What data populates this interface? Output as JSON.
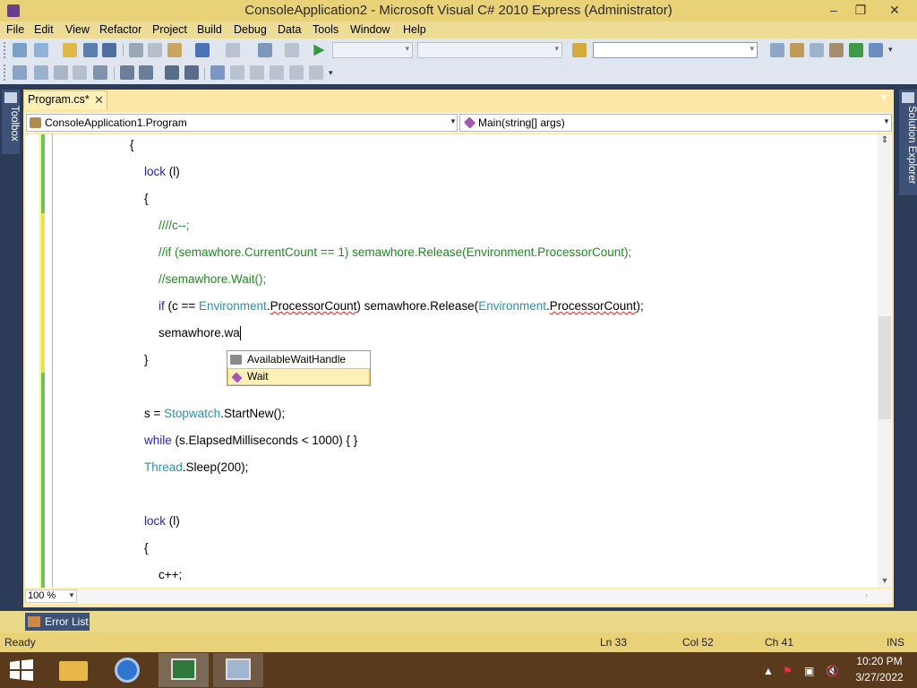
{
  "window": {
    "title": "ConsoleApplication2 - Microsoft Visual C# 2010 Express (Administrator)",
    "minimize": "–",
    "restore": "❐",
    "close": "✕"
  },
  "menu": [
    "File",
    "Edit",
    "View",
    "Refactor",
    "Project",
    "Build",
    "Debug",
    "Data",
    "Tools",
    "Window",
    "Help"
  ],
  "toolbar": {
    "find_value": "",
    "colors": {
      "background": "#dfe6ef"
    }
  },
  "side_tabs": {
    "toolbox": "Toolbox",
    "solution_explorer": "Solution Explorer"
  },
  "document_tab": {
    "label": "Program.cs*",
    "close": "✕",
    "overflow": "▼"
  },
  "navigation": {
    "type_combo": "ConsoleApplication1.Program",
    "member_combo": "Main(string[] args)"
  },
  "code_lines": [
    {
      "indent": 0,
      "tokens": [
        {
          "t": "{",
          "c": ""
        }
      ]
    },
    {
      "indent": 1,
      "tokens": [
        {
          "t": "lock",
          "c": "kw"
        },
        {
          "t": " (l)",
          "c": ""
        }
      ]
    },
    {
      "indent": 1,
      "tokens": [
        {
          "t": "{",
          "c": ""
        }
      ]
    },
    {
      "indent": 2,
      "tokens": [
        {
          "t": "////c--;",
          "c": "cm"
        }
      ]
    },
    {
      "indent": 2,
      "tokens": [
        {
          "t": "//if (semawhore.CurrentCount == 1) semawhore.Release(Environment.ProcessorCount);",
          "c": "cm"
        }
      ]
    },
    {
      "indent": 2,
      "tokens": [
        {
          "t": "//semawhore.Wait();",
          "c": "cm"
        }
      ]
    },
    {
      "indent": 2,
      "tokens": [
        {
          "t": "if",
          "c": "kw"
        },
        {
          "t": " (c == ",
          "c": ""
        },
        {
          "t": "Environment",
          "c": "ty"
        },
        {
          "t": ".",
          "c": ""
        },
        {
          "t": "ProcessorCount",
          "c": "squig"
        },
        {
          "t": ") semawhore.Release(",
          "c": ""
        },
        {
          "t": "Environment",
          "c": "ty"
        },
        {
          "t": ".",
          "c": ""
        },
        {
          "t": "ProcessorCount",
          "c": "squig"
        },
        {
          "t": ");",
          "c": ""
        }
      ]
    },
    {
      "indent": 2,
      "tokens": [
        {
          "t": "semawhore.wa",
          "c": ""
        }
      ],
      "caret": true
    },
    {
      "indent": 1,
      "tokens": [
        {
          "t": "}",
          "c": ""
        }
      ]
    },
    {
      "indent": 1,
      "tokens": []
    },
    {
      "indent": 1,
      "tokens": [
        {
          "t": "s = ",
          "c": ""
        },
        {
          "t": "Stopwatch",
          "c": "ty"
        },
        {
          "t": ".StartNew();",
          "c": ""
        }
      ]
    },
    {
      "indent": 1,
      "tokens": [
        {
          "t": "while",
          "c": "kw"
        },
        {
          "t": " (s.ElapsedMilliseconds < 1000) { }",
          "c": ""
        }
      ]
    },
    {
      "indent": 1,
      "tokens": [
        {
          "t": "Thread",
          "c": "ty"
        },
        {
          "t": ".Sleep(200);",
          "c": ""
        }
      ]
    },
    {
      "indent": 1,
      "tokens": []
    },
    {
      "indent": 1,
      "tokens": [
        {
          "t": "lock",
          "c": "kw"
        },
        {
          "t": " (l)",
          "c": ""
        }
      ]
    },
    {
      "indent": 1,
      "tokens": [
        {
          "t": "{",
          "c": ""
        }
      ]
    },
    {
      "indent": 2,
      "tokens": [
        {
          "t": "c++;",
          "c": ""
        }
      ]
    }
  ],
  "intellisense": {
    "items": [
      {
        "label": "AvailableWaitHandle",
        "icon": "property-icon",
        "selected": false
      },
      {
        "label": "Wait",
        "icon": "method-icon",
        "selected": true
      }
    ]
  },
  "editor_footer": {
    "zoom": "100 %"
  },
  "error_list": {
    "label": "Error List"
  },
  "status": {
    "ready": "Ready",
    "line": "Ln 33",
    "col": "Col 52",
    "ch": "Ch 41",
    "mode": "INS"
  },
  "taskbar": {
    "time": "10:20 PM",
    "date": "3/27/2022"
  }
}
